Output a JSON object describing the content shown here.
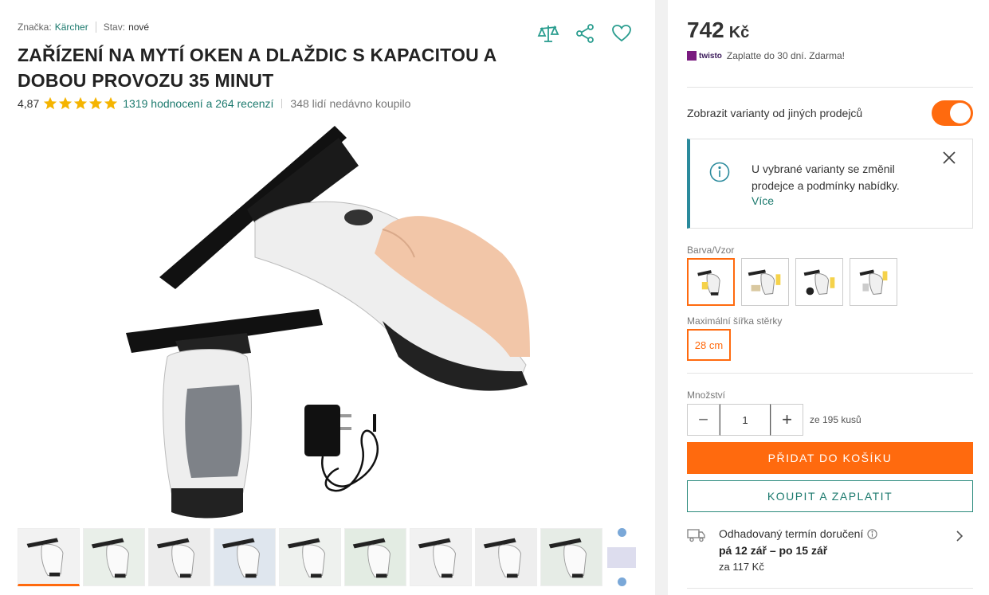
{
  "meta": {
    "brand_label": "Značka:",
    "brand_value": "Kärcher",
    "condition_label": "Stav:",
    "condition_value": "nové"
  },
  "product": {
    "title": "ZAŘÍZENÍ NA MYTÍ OKEN A DLAŽDIC S KAPACITOU A DOBOU PROVOZU 35 MINUT",
    "rating_score": "4,87",
    "rating_stars": 5,
    "reviews_link": "1319 hodnocení a 264 recenzí",
    "recently_bought": "348 lidí nedávno koupilo"
  },
  "price": {
    "amount": "742",
    "currency": "Kč"
  },
  "twisto": {
    "brand": "twisto",
    "text": "Zaplatte do 30 dní. Zdarma!"
  },
  "toggle": {
    "label": "Zobrazit varianty od jiných prodejců",
    "on": true
  },
  "notice": {
    "text": "U vybrané varianty se změnil prodejce a podmínky nabídky.",
    "more": "Více"
  },
  "variants": {
    "label": "Barva/Vzor",
    "selected_index": 0
  },
  "size": {
    "label": "Maximální šířka stěrky",
    "option": "28 cm"
  },
  "quantity": {
    "label": "Množství",
    "value": "1",
    "minus": "−",
    "plus": "+",
    "stock": "ze 195 kusů"
  },
  "buttons": {
    "add_to_cart": "PŘIDAT DO KOŠÍKU",
    "buy_now": "KOUPIT A ZAPLATIT"
  },
  "delivery": {
    "title": "Odhadovaný termín doručení",
    "dates": "pá 12 zář – po 15 zář",
    "price": "za 117 Kč"
  },
  "colors": {
    "accent": "#ff6a0e",
    "link": "#1c7a6e",
    "info": "#2a8a9c"
  }
}
